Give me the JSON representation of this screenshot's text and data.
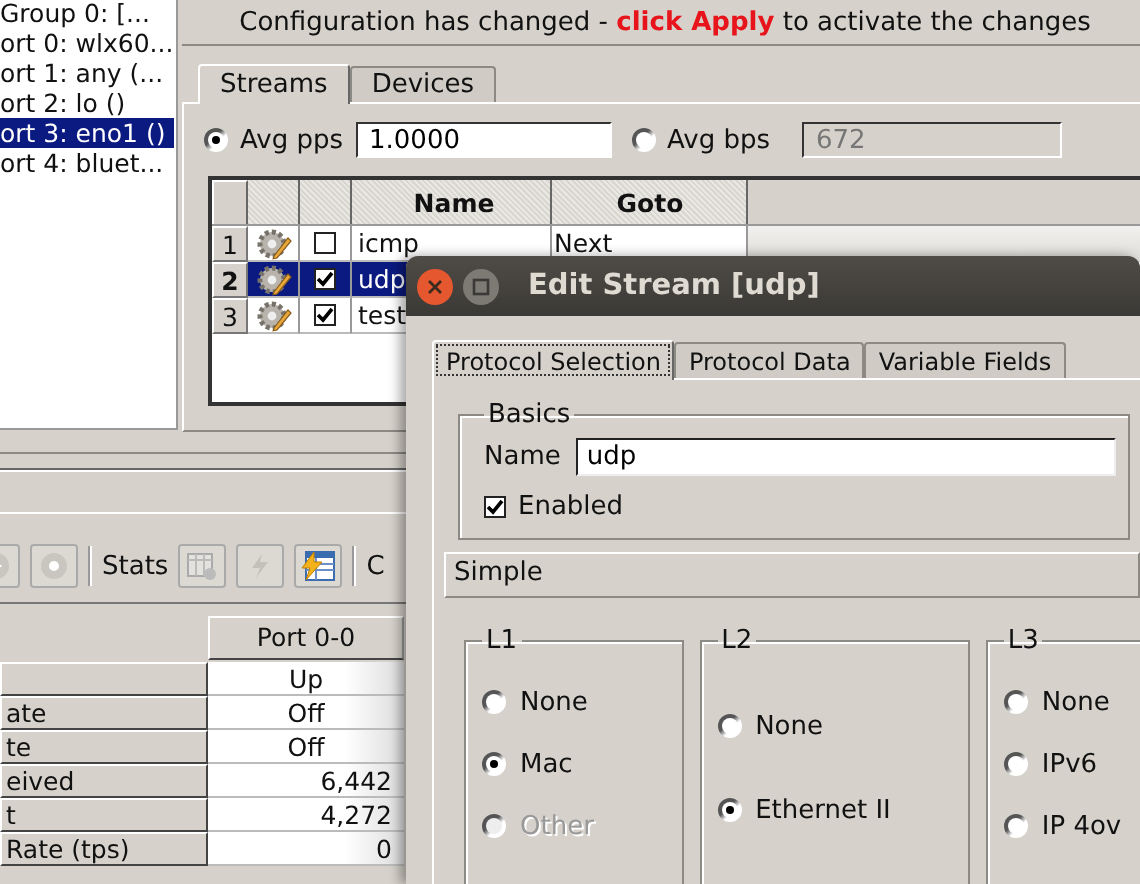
{
  "port_tree": {
    "items": [
      {
        "label": "Group 0:  [...",
        "selected": false
      },
      {
        "label": "ort 0: wlx60...",
        "selected": false
      },
      {
        "label": "ort 1: any (...",
        "selected": false
      },
      {
        "label": "ort 2: lo ()",
        "selected": false
      },
      {
        "label": "ort 3: eno1 ()",
        "selected": true
      },
      {
        "label": "ort 4: bluet...",
        "selected": false
      }
    ]
  },
  "banner": {
    "text": "Configuration has changed - **click Apply** to activate the changes"
  },
  "stream_tabs": [
    {
      "label": "Streams",
      "selected": true
    },
    {
      "label": "Devices",
      "selected": false
    }
  ],
  "rate": {
    "options": [
      {
        "label": "Avg pps",
        "selected": true,
        "value": "1.0000",
        "disabled": false
      },
      {
        "label": "Avg bps",
        "selected": false,
        "value": "672",
        "disabled": true
      }
    ]
  },
  "streams_table": {
    "columns": [
      "Name",
      "Goto"
    ],
    "rows": [
      {
        "index": "1",
        "enabled": false,
        "name": "icmp",
        "goto": "Next",
        "selected": false
      },
      {
        "index": "2",
        "enabled": true,
        "name": "udp",
        "selected": true
      },
      {
        "index": "3",
        "enabled": true,
        "name": "test",
        "selected": false
      }
    ]
  },
  "toolbar": {
    "stats_label": "Stats",
    "next_label": "C"
  },
  "stats_table": {
    "columns": [
      "Port 0-0"
    ],
    "rows": [
      {
        "value": "Up",
        "kind": "state"
      },
      {
        "label": "ate",
        "value": "Off",
        "kind": "state"
      },
      {
        "label": "te",
        "value": "Off",
        "kind": "state"
      },
      {
        "label": "eived",
        "value": "6,442",
        "kind": "count"
      },
      {
        "label": "t",
        "value": "4,272",
        "kind": "count"
      },
      {
        "label": "Rate (tps)",
        "value": "0",
        "kind": "count"
      }
    ]
  },
  "dialog": {
    "title": "Edit Stream [udp]",
    "tabs": [
      {
        "label": "Protocol Selection",
        "selected": true
      },
      {
        "label": "Protocol Data",
        "selected": false
      },
      {
        "label": "Variable Fields",
        "selected": false
      }
    ],
    "basics": {
      "title": "Basics",
      "name_label": "Name",
      "name_value": "udp",
      "enabled": {
        "label": "Enabled",
        "checked": true
      }
    },
    "section": "Simple",
    "groups": [
      {
        "title": "L1",
        "options": [
          {
            "label": "None",
            "selected": false,
            "disabled": false
          },
          {
            "label": "Mac",
            "selected": true,
            "disabled": false
          },
          {
            "label": "Other",
            "selected": false,
            "disabled": true
          }
        ]
      },
      {
        "title": "L2",
        "options": [
          {
            "label": "None",
            "selected": false,
            "disabled": false
          },
          {
            "label": "Ethernet II",
            "selected": true,
            "disabled": false
          }
        ]
      },
      {
        "title": "L3",
        "options": [
          {
            "label": "None",
            "selected": false,
            "disabled": false
          },
          {
            "label": "IPv6",
            "selected": false,
            "disabled": false
          },
          {
            "label": "IP 4ov",
            "selected": false,
            "disabled": false
          }
        ]
      }
    ]
  }
}
